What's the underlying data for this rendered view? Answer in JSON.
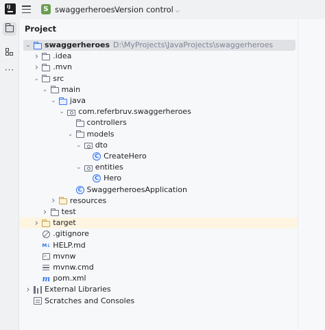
{
  "titlebar": {
    "logo": "jetbrains-logo-icon",
    "menu_icon": "hamburger-menu-icon",
    "project_badge": "S",
    "project_name": "swaggerheroes",
    "vcs_label": "Version control"
  },
  "left_strip": {
    "items": [
      "project-folder-icon",
      "structure-icon",
      "more-icon"
    ]
  },
  "panel": {
    "title": "Project"
  },
  "tree": [
    {
      "label": "swaggerheroes",
      "path": "D:\\MyProjects\\JavaProjects\\swaggerheroes",
      "depth": 0,
      "arrow": "down",
      "icon": "module-folder",
      "selected": true,
      "bold": true
    },
    {
      "label": ".idea",
      "depth": 1,
      "arrow": "right",
      "icon": "folder"
    },
    {
      "label": ".mvn",
      "depth": 1,
      "arrow": "right",
      "icon": "folder"
    },
    {
      "label": "src",
      "depth": 1,
      "arrow": "down",
      "icon": "folder"
    },
    {
      "label": "main",
      "depth": 2,
      "arrow": "down",
      "icon": "folder"
    },
    {
      "label": "java",
      "depth": 3,
      "arrow": "down",
      "icon": "source-folder"
    },
    {
      "label": "com.referbruv.swaggerheroes",
      "depth": 4,
      "arrow": "down",
      "icon": "package"
    },
    {
      "label": "controllers",
      "depth": 5,
      "arrow": "",
      "icon": "folder"
    },
    {
      "label": "models",
      "depth": 5,
      "arrow": "down",
      "icon": "folder"
    },
    {
      "label": "dto",
      "depth": 6,
      "arrow": "down",
      "icon": "package"
    },
    {
      "label": "CreateHero",
      "depth": 7,
      "arrow": "",
      "icon": "class"
    },
    {
      "label": "entities",
      "depth": 6,
      "arrow": "down",
      "icon": "package"
    },
    {
      "label": "Hero",
      "depth": 7,
      "arrow": "",
      "icon": "class"
    },
    {
      "label": "SwaggerheroesApplication",
      "depth": 5,
      "arrow": "",
      "icon": "spring-class"
    },
    {
      "label": "resources",
      "depth": 3,
      "arrow": "right",
      "icon": "resources-folder"
    },
    {
      "label": "test",
      "depth": 2,
      "arrow": "right",
      "icon": "folder"
    },
    {
      "label": "target",
      "depth": 1,
      "arrow": "right",
      "icon": "excluded-folder",
      "highlight": true
    },
    {
      "label": ".gitignore",
      "depth": 1,
      "arrow": "",
      "icon": "ignore-file"
    },
    {
      "label": "HELP.md",
      "depth": 1,
      "arrow": "",
      "icon": "markdown-file"
    },
    {
      "label": "mvnw",
      "depth": 1,
      "arrow": "",
      "icon": "shell-file"
    },
    {
      "label": "mvnw.cmd",
      "depth": 1,
      "arrow": "",
      "icon": "text-file"
    },
    {
      "label": "pom.xml",
      "depth": 1,
      "arrow": "",
      "icon": "maven-file"
    },
    {
      "label": "External Libraries",
      "depth": 0,
      "arrow": "right",
      "icon": "libraries"
    },
    {
      "label": "Scratches and Consoles",
      "depth": 0,
      "arrow": "",
      "icon": "scratches"
    }
  ]
}
